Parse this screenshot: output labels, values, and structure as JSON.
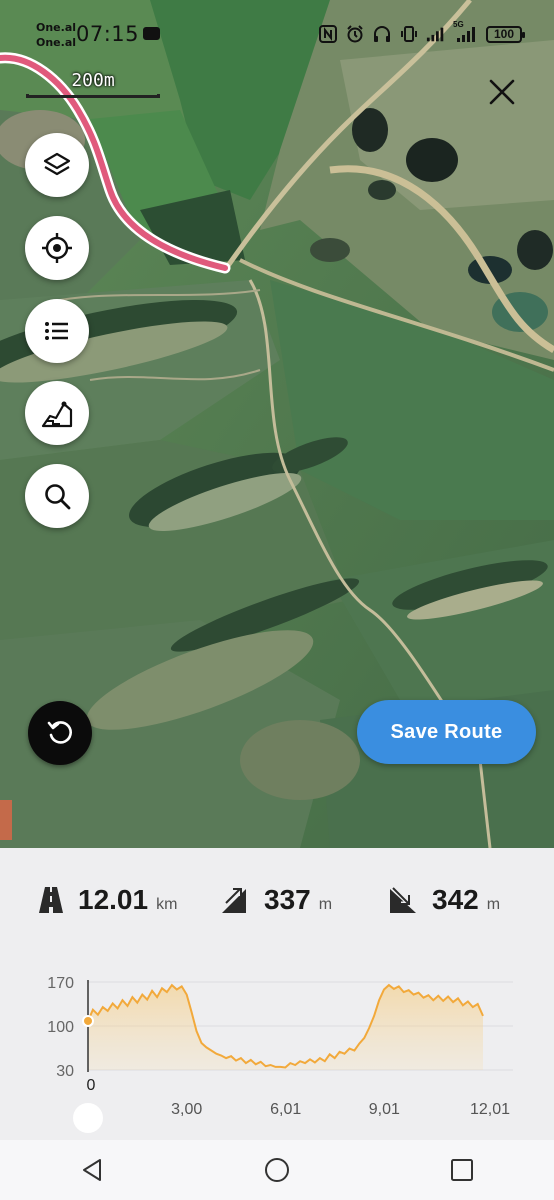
{
  "status_bar": {
    "carrier_1": "One.al",
    "carrier_2": "One.al",
    "time": "07:15",
    "network": "5G",
    "battery": "100"
  },
  "map": {
    "scale_label": "200m",
    "route_color": "#e05a7c"
  },
  "toolbar": {
    "layers_icon": "layers-icon",
    "locate_icon": "crosshair-icon",
    "list_icon": "list-icon",
    "elevation_icon": "route-profile-icon",
    "search_icon": "search-icon"
  },
  "actions": {
    "save_label": "Save Route",
    "save_color": "#3a8ee0"
  },
  "stats": {
    "distance_value": "12.01",
    "distance_unit": "km",
    "ascent_value": "337",
    "ascent_unit": "m",
    "descent_value": "342",
    "descent_unit": "m"
  },
  "chart_data": {
    "type": "area",
    "ylim": [
      30,
      170
    ],
    "y_ticks": [
      "170",
      "100",
      "30"
    ],
    "x_ticks": [
      "0",
      "3,00",
      "6,01",
      "9,01",
      "12,01"
    ],
    "x_tick_values": [
      0,
      3.0,
      6.01,
      9.01,
      12.01
    ],
    "xlim": [
      0,
      12.01
    ],
    "line_color": "#f2a93b",
    "series": [
      {
        "x": [
          0,
          0.15,
          0.3,
          0.45,
          0.6,
          0.75,
          0.9,
          1.05,
          1.2,
          1.35,
          1.5,
          1.65,
          1.8,
          1.95,
          2.1,
          2.25,
          2.4,
          2.55,
          2.7,
          2.85,
          3.0,
          3.15,
          3.3,
          3.45,
          3.6,
          3.75,
          3.9,
          4.05,
          4.2,
          4.35,
          4.5,
          4.65,
          4.8,
          4.95,
          5.1,
          5.25,
          5.4,
          5.55,
          5.7,
          5.85,
          6.0,
          6.15,
          6.3,
          6.45,
          6.6,
          6.75,
          6.9,
          7.05,
          7.2,
          7.35,
          7.5,
          7.65,
          7.8,
          7.95,
          8.1,
          8.25,
          8.4,
          8.55,
          8.7,
          8.85,
          9.0,
          9.15,
          9.3,
          9.45,
          9.6,
          9.75,
          9.9,
          10.05,
          10.2,
          10.35,
          10.5,
          10.65,
          10.8,
          10.95,
          11.1,
          11.25,
          11.4,
          11.55,
          11.7,
          11.85,
          12.01
        ],
        "y": [
          108,
          126,
          118,
          130,
          124,
          136,
          128,
          141,
          132,
          146,
          137,
          150,
          142,
          156,
          146,
          160,
          154,
          165,
          158,
          163,
          150,
          122,
          92,
          73,
          66,
          61,
          56,
          53,
          49,
          52,
          45,
          49,
          41,
          46,
          39,
          43,
          36,
          38,
          35,
          35,
          34,
          41,
          38,
          44,
          41,
          47,
          42,
          49,
          44,
          55,
          49,
          59,
          56,
          64,
          61,
          72,
          81,
          97,
          116,
          141,
          158,
          165,
          159,
          163,
          154,
          157,
          150,
          153,
          145,
          149,
          141,
          148,
          140,
          147,
          138,
          144,
          133,
          139,
          130,
          135,
          116
        ]
      }
    ]
  },
  "nav": {
    "back_icon": "back-icon",
    "home_icon": "home-icon",
    "recents_icon": "recents-icon"
  }
}
